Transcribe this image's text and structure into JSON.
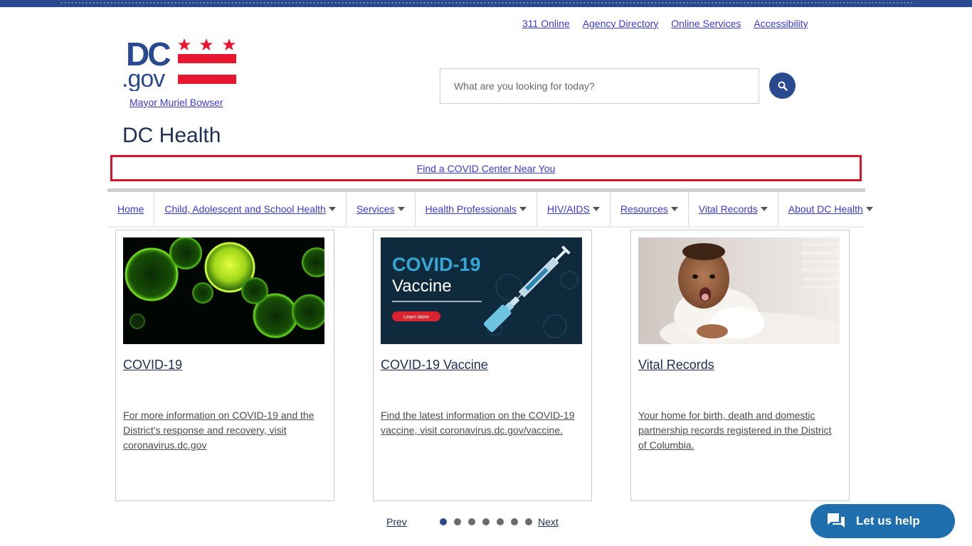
{
  "header": {
    "utility_links": [
      "311 Online",
      "Agency Directory",
      "Online Services",
      "Accessibility"
    ],
    "logo": {
      "text_dc": "DC",
      "text_gov": ".gov",
      "flag_colors": {
        "red": "#e8162f",
        "blue": "#2a4a8f"
      }
    },
    "mayor_link": "Mayor Muriel Bowser",
    "search": {
      "placeholder": "What are you looking for today?",
      "icon": "search-icon"
    }
  },
  "agency_title": "DC Health",
  "alert": {
    "link": "Find a COVID Center Near You",
    "border_color": "#d9142b"
  },
  "nav": {
    "items": [
      {
        "label": "Home",
        "has_dropdown": false
      },
      {
        "label": "Child, Adolescent and School Health",
        "has_dropdown": true
      },
      {
        "label": "Services",
        "has_dropdown": true
      },
      {
        "label": "Health Professionals",
        "has_dropdown": true
      },
      {
        "label": "HIV/AIDS",
        "has_dropdown": true
      },
      {
        "label": "Resources",
        "has_dropdown": true
      },
      {
        "label": "Vital Records",
        "has_dropdown": true
      },
      {
        "label": "About DC Health",
        "has_dropdown": true
      }
    ]
  },
  "cards": [
    {
      "title": "COVID-19",
      "description": "For more information on COVID-19 and the District's response and recovery, visit coronavirus.dc.gov",
      "image": "covid-virus-image"
    },
    {
      "title": "COVID-19 Vaccine",
      "description": "Find the latest information on the COVID-19 vaccine, visit coronavirus.dc.gov/vaccine.",
      "image": "covid-vaccine-banner",
      "image_text": {
        "headline": "COVID-19",
        "sub": "Vaccine",
        "button": "Learn More"
      }
    },
    {
      "title": "Vital Records",
      "description": "Your home for birth, death and domestic partnership records registered in the District of Columbia.",
      "image": "baby-photo"
    }
  ],
  "pager": {
    "prev": "Prev",
    "next": "Next",
    "total_dots": 7,
    "active_index": 0
  },
  "chat": {
    "label": "Let us help",
    "icon": "chat-icon",
    "color": "#1f6fae"
  }
}
